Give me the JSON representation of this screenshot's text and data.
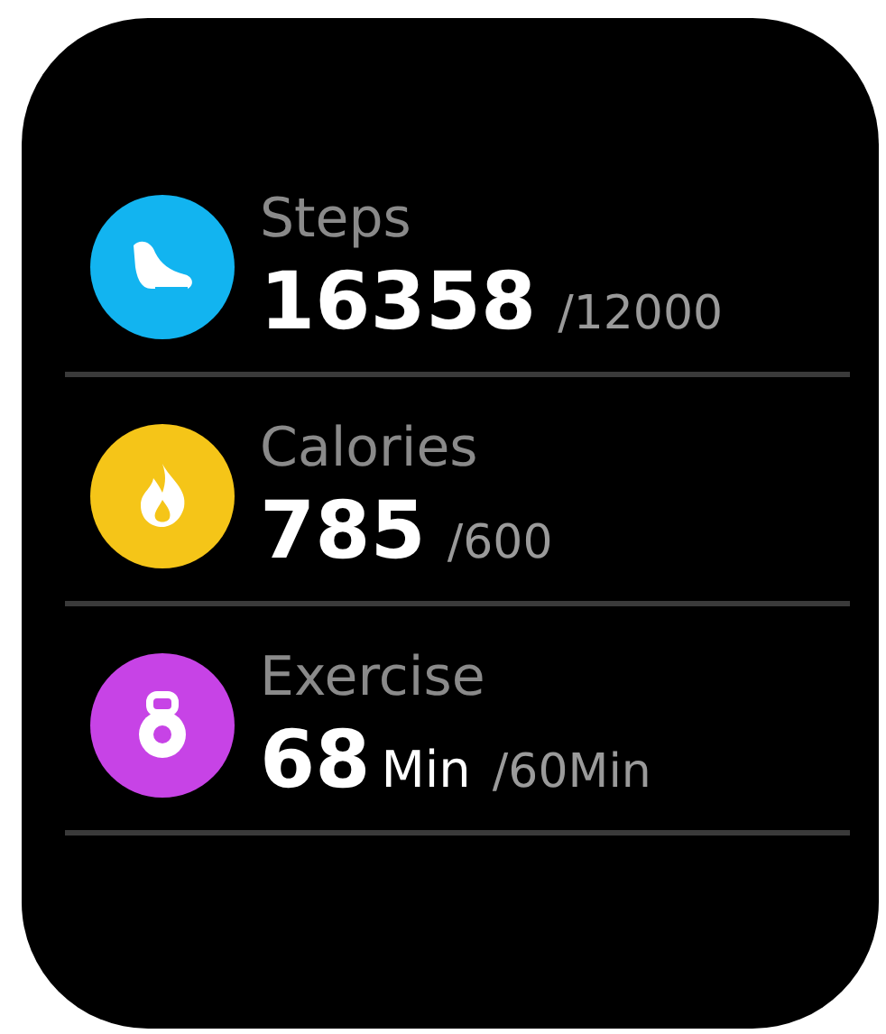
{
  "metrics": [
    {
      "kind": "steps",
      "color": "#12b4f0",
      "title": "Steps",
      "value": "16358",
      "goal": "/12000"
    },
    {
      "kind": "calories",
      "color": "#f5c518",
      "title": "Calories",
      "value": "785",
      "goal": "/600"
    },
    {
      "kind": "exercise",
      "color": "#c743e6",
      "title": "Exercise",
      "value": "68",
      "unit": "Min",
      "goal": "/60Min"
    }
  ]
}
